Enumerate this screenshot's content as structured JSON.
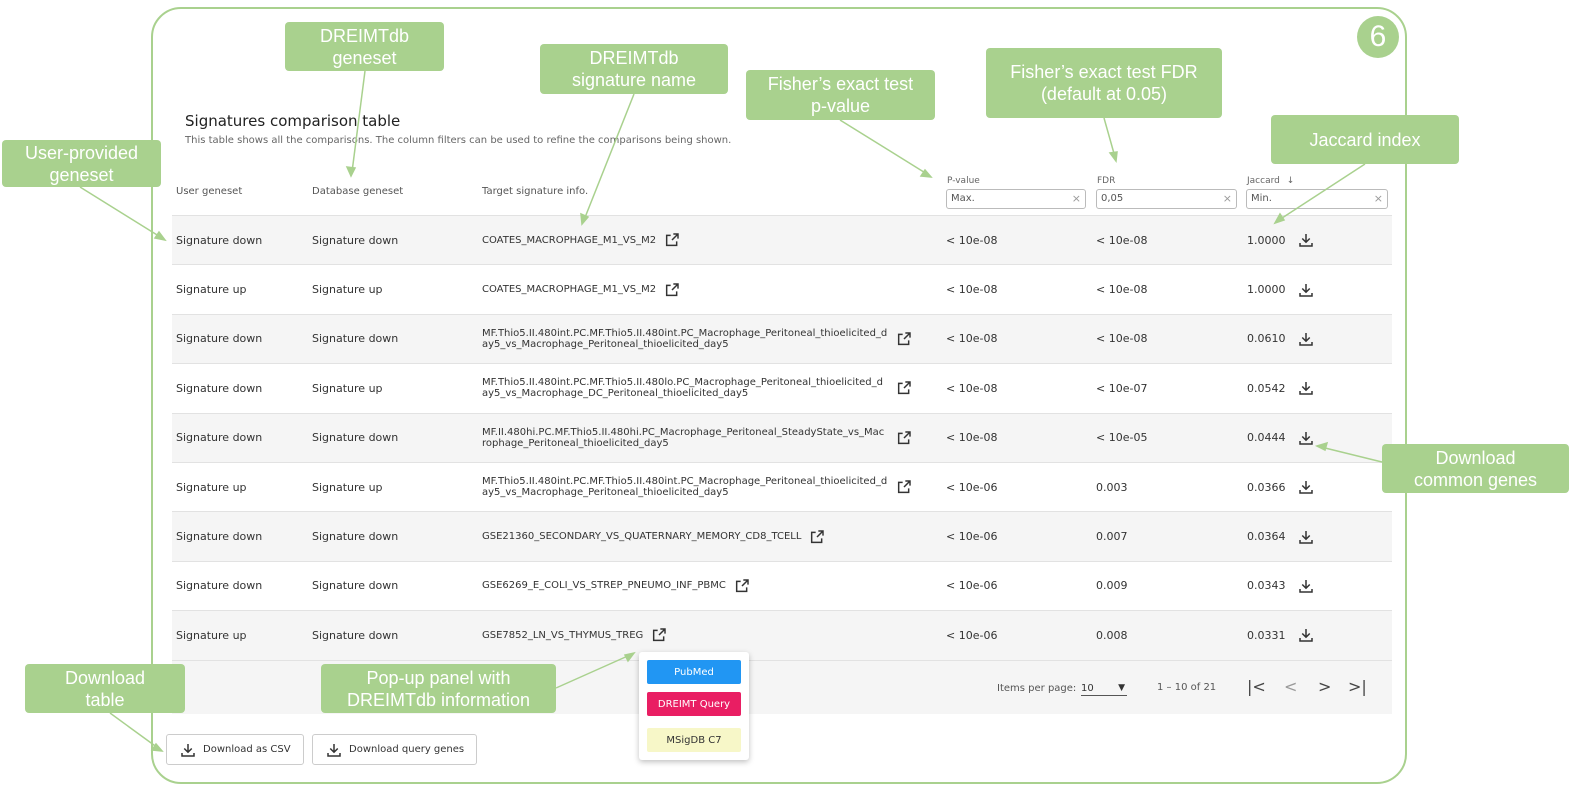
{
  "step_number": "6",
  "table": {
    "title": "Signatures comparison table",
    "subtitle": "This table shows all the comparisons. The column filters can be used to refine the comparisons being shown.",
    "headers": {
      "user": "User geneset",
      "db": "Database geneset",
      "target": "Target signature info.",
      "pvalue": "P-value",
      "fdr": "FDR",
      "jaccard": "Jaccard",
      "sort_arrow": "↓"
    },
    "filters": {
      "pvalue_placeholder": "Max.",
      "fdr_value": "0,05",
      "jaccard_placeholder": "Min.",
      "clear": "×"
    },
    "rows": [
      {
        "user": "Signature down",
        "db": "Signature down",
        "target": "COATES_MACROPHAGE_M1_VS_M2",
        "pvalue": "< 10e-08",
        "fdr": "< 10e-08",
        "jaccard": "1.0000"
      },
      {
        "user": "Signature up",
        "db": "Signature up",
        "target": "COATES_MACROPHAGE_M1_VS_M2",
        "pvalue": "< 10e-08",
        "fdr": "< 10e-08",
        "jaccard": "1.0000"
      },
      {
        "user": "Signature down",
        "db": "Signature down",
        "target": "MF.Thio5.II.480int.PC.MF.Thio5.II.480int.PC_Macrophage_Peritoneal_thioelicited_day5_vs_Macrophage_Peritoneal_thioelicited_day5",
        "pvalue": "< 10e-08",
        "fdr": "< 10e-08",
        "jaccard": "0.0610"
      },
      {
        "user": "Signature down",
        "db": "Signature up",
        "target": "MF.Thio5.II.480int.PC.MF.Thio5.II.480lo.PC_Macrophage_Peritoneal_thioelicited_day5_vs_Macrophage_DC_Peritoneal_thioelicited_day5",
        "pvalue": "< 10e-08",
        "fdr": "< 10e-07",
        "jaccard": "0.0542"
      },
      {
        "user": "Signature down",
        "db": "Signature down",
        "target": "MF.II.480hi.PC.MF.Thio5.II.480hi.PC_Macrophage_Peritoneal_SteadyState_vs_Macrophage_Peritoneal_thioelicited_day5",
        "pvalue": "< 10e-08",
        "fdr": "< 10e-05",
        "jaccard": "0.0444"
      },
      {
        "user": "Signature up",
        "db": "Signature up",
        "target": "MF.Thio5.II.480int.PC.MF.Thio5.II.480int.PC_Macrophage_Peritoneal_thioelicited_day5_vs_Macrophage_Peritoneal_thioelicited_day5",
        "pvalue": "< 10e-06",
        "fdr": "0.003",
        "jaccard": "0.0366"
      },
      {
        "user": "Signature down",
        "db": "Signature down",
        "target": "GSE21360_SECONDARY_VS_QUATERNARY_MEMORY_CD8_TCELL",
        "pvalue": "< 10e-06",
        "fdr": "0.007",
        "jaccard": "0.0364"
      },
      {
        "user": "Signature down",
        "db": "Signature down",
        "target": "GSE6269_E_COLI_VS_STREP_PNEUMO_INF_PBMC",
        "pvalue": "< 10e-06",
        "fdr": "0.009",
        "jaccard": "0.0343"
      },
      {
        "user": "Signature up",
        "db": "Signature down",
        "target": "GSE7852_LN_VS_THYMUS_TREG",
        "pvalue": "< 10e-06",
        "fdr": "0.008",
        "jaccard": "0.0331"
      }
    ]
  },
  "pagination": {
    "items_per_page_label": "Items per page:",
    "items_per_page_value": "10",
    "range_label": "1 – 10 of 21",
    "first": "|<",
    "prev": "<",
    "next": ">",
    "last": ">|"
  },
  "popup": {
    "pubmed": "PubMed",
    "dreimt_query": "DREIMT Query",
    "msigdb": "MSigDB C7"
  },
  "buttons": {
    "download_csv": "Download as CSV",
    "download_query_genes": "Download query genes"
  },
  "callouts": {
    "user_geneset": "User-provided\ngeneset",
    "db_geneset": "DREIMTdb\ngeneset",
    "signature_name": "DREIMTdb\nsignature name",
    "fisher_p": "Fisher’s exact test\np-value",
    "fisher_fdr": "Fisher’s exact test FDR\n(default at 0.05)",
    "jaccard": "Jaccard index",
    "download_common": "Download\ncommon genes",
    "download_table": "Download\ntable",
    "popup_panel": "Pop-up panel with\nDREIMTdb information"
  },
  "colors": {
    "callout_green": "#a9d18e",
    "pubmed_blue": "#2196f3",
    "dreimt_pink": "#e91e63",
    "msigdb_yellow": "#f7f7c8"
  }
}
